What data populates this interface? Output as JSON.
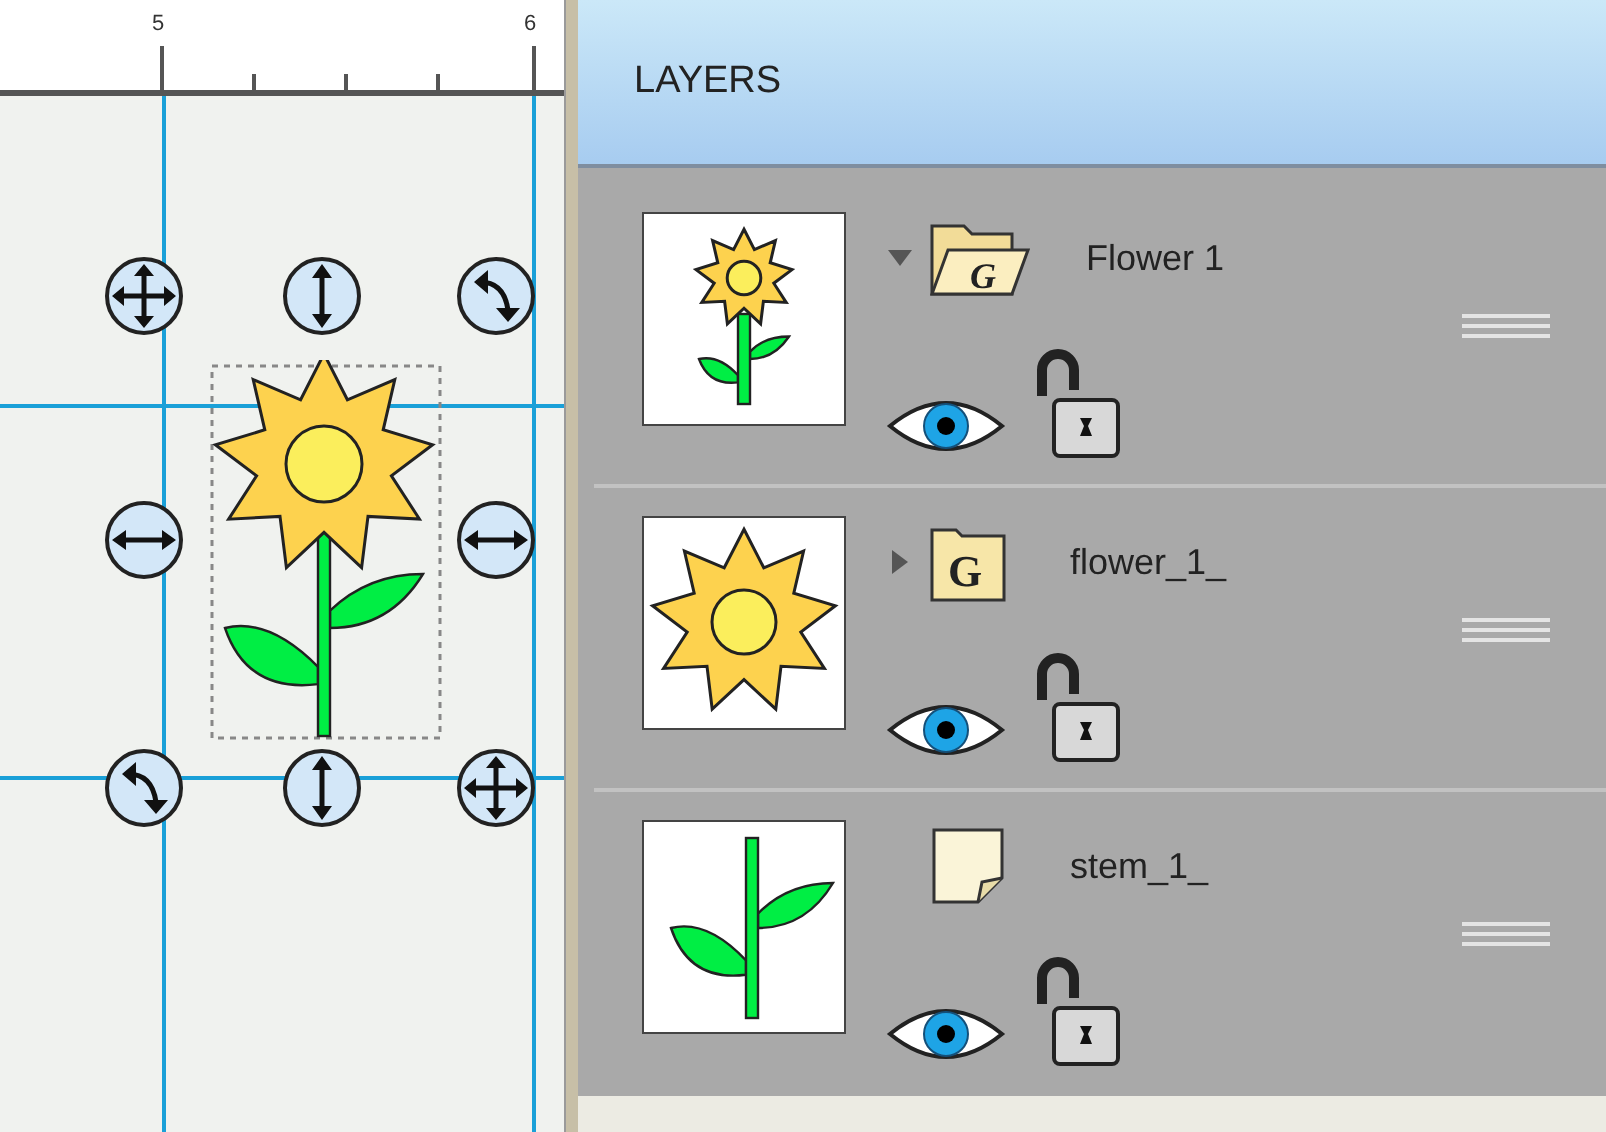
{
  "ruler": {
    "labels": [
      "5",
      "6"
    ]
  },
  "panel": {
    "title": "LAYERS"
  },
  "layers": [
    {
      "name": "Flower 1",
      "kind": "group",
      "badge": "G",
      "expanded": true,
      "thumbnail": {
        "kind": "flower"
      },
      "visible": true,
      "locked": false
    },
    {
      "name": "flower_1_",
      "kind": "group",
      "badge": "G",
      "expanded": false,
      "thumbnail": {
        "kind": "bloom"
      },
      "visible": true,
      "locked": false
    },
    {
      "name": "stem_1_",
      "kind": "path",
      "thumbnail": {
        "kind": "stem"
      },
      "visible": true,
      "locked": false
    }
  ]
}
